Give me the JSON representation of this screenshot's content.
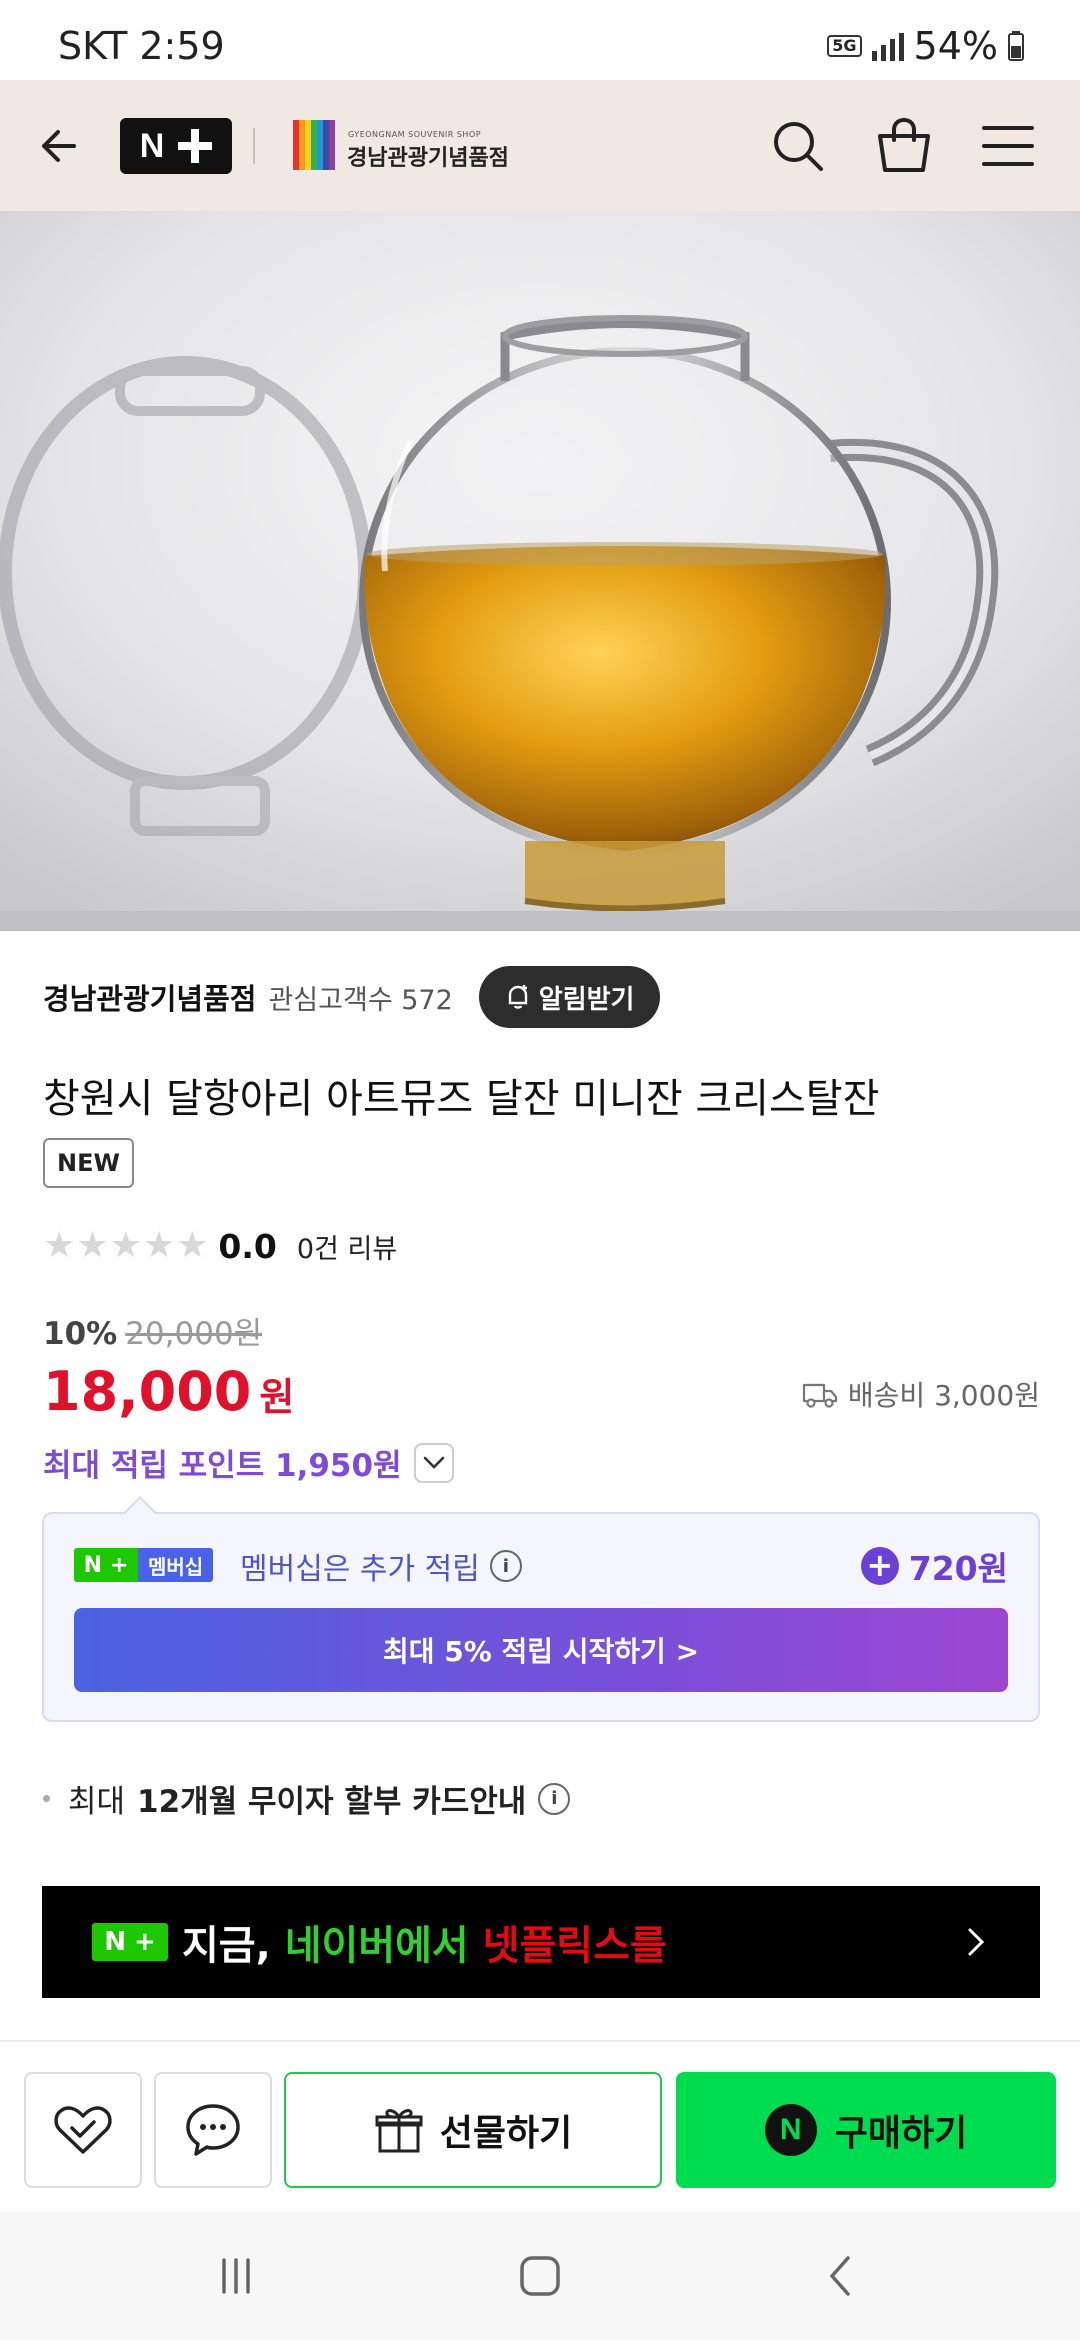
{
  "status_bar": {
    "carrier_time": "SKT 2:59",
    "network": "5G",
    "battery": "54%"
  },
  "header": {
    "nplus_logo_text": "N",
    "shop_logo_subtitle": "GYEONGNAM SOUVENIR SHOP",
    "shop_logo_name": "경남관광기념품점",
    "icons": [
      "back-arrow-icon",
      "search-icon",
      "shopping-bag-icon",
      "menu-icon"
    ]
  },
  "store": {
    "name": "경남관광기념품점",
    "followers": "관심고객수 572",
    "notify_label": "알림받기"
  },
  "product": {
    "title": "창원시 달항아리 아트뮤즈 달잔 미니잔 크리스탈잔",
    "badge": "NEW",
    "rating": "0.0",
    "rating_fraction": 0,
    "review_count": "0건 리뷰",
    "discount_rate": "10%",
    "original_price": "20,000원",
    "price": "18,000",
    "price_unit": "원",
    "shipping": "배송비 3,000원",
    "points": "최대 적립 포인트 1,950원"
  },
  "membership": {
    "badge_n": "N",
    "badge_text": "멤버십",
    "message": "멤버십은 추가 적립",
    "extra_points": "720원",
    "cta": "최대 5% 적립 시작하기 >"
  },
  "installment": {
    "prefix": "최대",
    "bold": "12개월 무이자 할부 카드안내"
  },
  "banner": {
    "badge_n": "N",
    "text_white": "지금, ",
    "text_green": "네이버에서 ",
    "text_red": "넷플릭스를"
  },
  "actions": {
    "gift_label": "선물하기",
    "buy_label": "구매하기",
    "buy_icon_letter": "N"
  },
  "colors": {
    "header_bg": "#efe9e1",
    "price_red": "#e0112b",
    "points_purple": "#7d4bd8",
    "naver_green": "#00dc50"
  }
}
